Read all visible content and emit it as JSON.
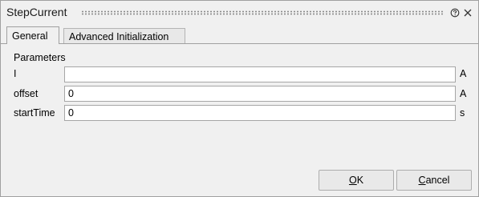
{
  "window": {
    "title": "StepCurrent",
    "help_icon": "help-circle-icon",
    "close_icon": "close-icon"
  },
  "tabs": [
    {
      "label": "General",
      "active": true
    },
    {
      "label": "Advanced Initialization",
      "active": false
    }
  ],
  "parameters": {
    "section_label": "Parameters",
    "rows": [
      {
        "label": "I",
        "value": "",
        "unit": "A"
      },
      {
        "label": "offset",
        "value": "0",
        "unit": "A"
      },
      {
        "label": "startTime",
        "value": "0",
        "unit": "s"
      }
    ]
  },
  "buttons": {
    "ok_mnemonic": "O",
    "ok_rest": "K",
    "cancel_mnemonic": "C",
    "cancel_rest": "ancel"
  }
}
